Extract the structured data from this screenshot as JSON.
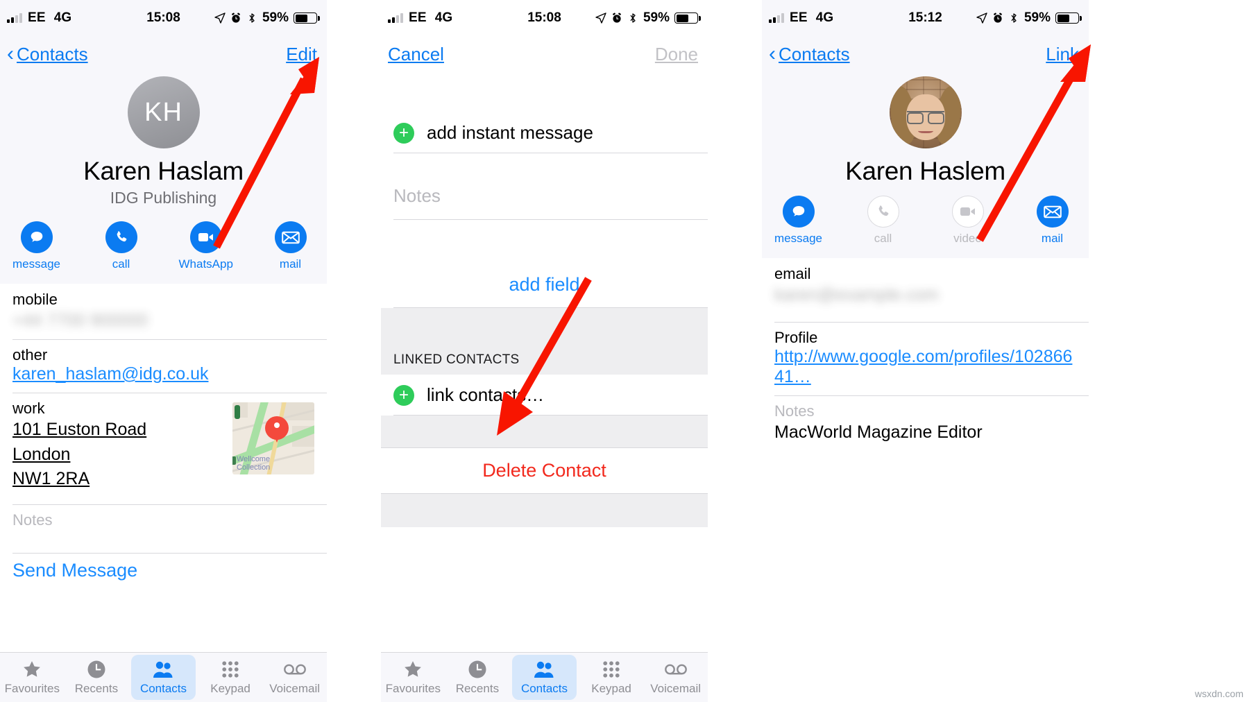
{
  "panels": [
    {
      "id": "contact-view",
      "status": {
        "carrier": "EE",
        "network": "4G",
        "time": "15:08",
        "battery_pct": "59%"
      },
      "nav": {
        "back_label": "Contacts",
        "right_label": "Edit"
      },
      "contact": {
        "initials": "KH",
        "name": "Karen Haslam",
        "org": "IDG Publishing"
      },
      "actions": [
        {
          "label": "message",
          "icon": "message-icon"
        },
        {
          "label": "call",
          "icon": "phone-icon"
        },
        {
          "label": "WhatsApp",
          "icon": "video-icon"
        },
        {
          "label": "mail",
          "icon": "mail-icon"
        }
      ],
      "fields": [
        {
          "label": "mobile",
          "value": "",
          "kind": "blurred"
        },
        {
          "label": "other",
          "value": "karen_haslam@idg.co.uk",
          "kind": "link"
        },
        {
          "label": "work",
          "value": "101 Euston Road\nLondon\nNW1 2RA",
          "kind": "address"
        },
        {
          "label": "Notes",
          "value": "",
          "kind": "placeholder"
        }
      ],
      "map": {
        "poi": "Wellcome\nCollection"
      },
      "send_message": "Send Message",
      "tabs": [
        {
          "label": "Favourites",
          "icon": "star-icon",
          "active": false
        },
        {
          "label": "Recents",
          "icon": "clock-icon",
          "active": false
        },
        {
          "label": "Contacts",
          "icon": "people-icon",
          "active": true
        },
        {
          "label": "Keypad",
          "icon": "keypad-icon",
          "active": false
        },
        {
          "label": "Voicemail",
          "icon": "voicemail-icon",
          "active": false
        }
      ]
    },
    {
      "id": "contact-edit",
      "status": {
        "carrier": "EE",
        "network": "4G",
        "time": "15:08",
        "battery_pct": "59%"
      },
      "nav": {
        "left_label": "Cancel",
        "right_label": "Done"
      },
      "rows": [
        {
          "label": "add instant message",
          "icon": "plus-icon"
        }
      ],
      "notes_placeholder": "Notes",
      "add_field_label": "add field",
      "section_header": "LINKED CONTACTS",
      "link_row": {
        "label": "link contacts…",
        "icon": "plus-icon"
      },
      "delete_label": "Delete Contact",
      "tabs": [
        {
          "label": "Favourites",
          "icon": "star-icon",
          "active": false
        },
        {
          "label": "Recents",
          "icon": "clock-icon",
          "active": false
        },
        {
          "label": "Contacts",
          "icon": "people-icon",
          "active": true
        },
        {
          "label": "Keypad",
          "icon": "keypad-icon",
          "active": false
        },
        {
          "label": "Voicemail",
          "icon": "voicemail-icon",
          "active": false
        }
      ]
    },
    {
      "id": "contact-linked-view",
      "status": {
        "carrier": "EE",
        "network": "4G",
        "time": "15:12",
        "battery_pct": "59%"
      },
      "nav": {
        "back_label": "Contacts",
        "right_label": "Link"
      },
      "contact": {
        "name": "Karen Haslem",
        "photo": "contact-photo"
      },
      "actions": [
        {
          "label": "message",
          "icon": "message-icon",
          "enabled": true
        },
        {
          "label": "call",
          "icon": "phone-icon",
          "enabled": false
        },
        {
          "label": "video",
          "icon": "video-icon",
          "enabled": false
        },
        {
          "label": "mail",
          "icon": "mail-icon",
          "enabled": true
        }
      ],
      "fields": [
        {
          "label": "email",
          "value": "",
          "kind": "blurred"
        },
        {
          "label": "Profile",
          "value": "http://www.google.com/profiles/10286641…",
          "kind": "link"
        },
        {
          "label": "Notes",
          "value": "MacWorld Magazine Editor",
          "kind": "note"
        }
      ]
    }
  ],
  "annotations": {
    "arrows": [
      {
        "name": "arrow-to-edit",
        "target": "Edit"
      },
      {
        "name": "arrow-to-link-contacts",
        "target": "link contacts…"
      },
      {
        "name": "arrow-to-link",
        "target": "Link"
      }
    ],
    "color": "#f81500"
  },
  "watermark": "wsxdn.com"
}
